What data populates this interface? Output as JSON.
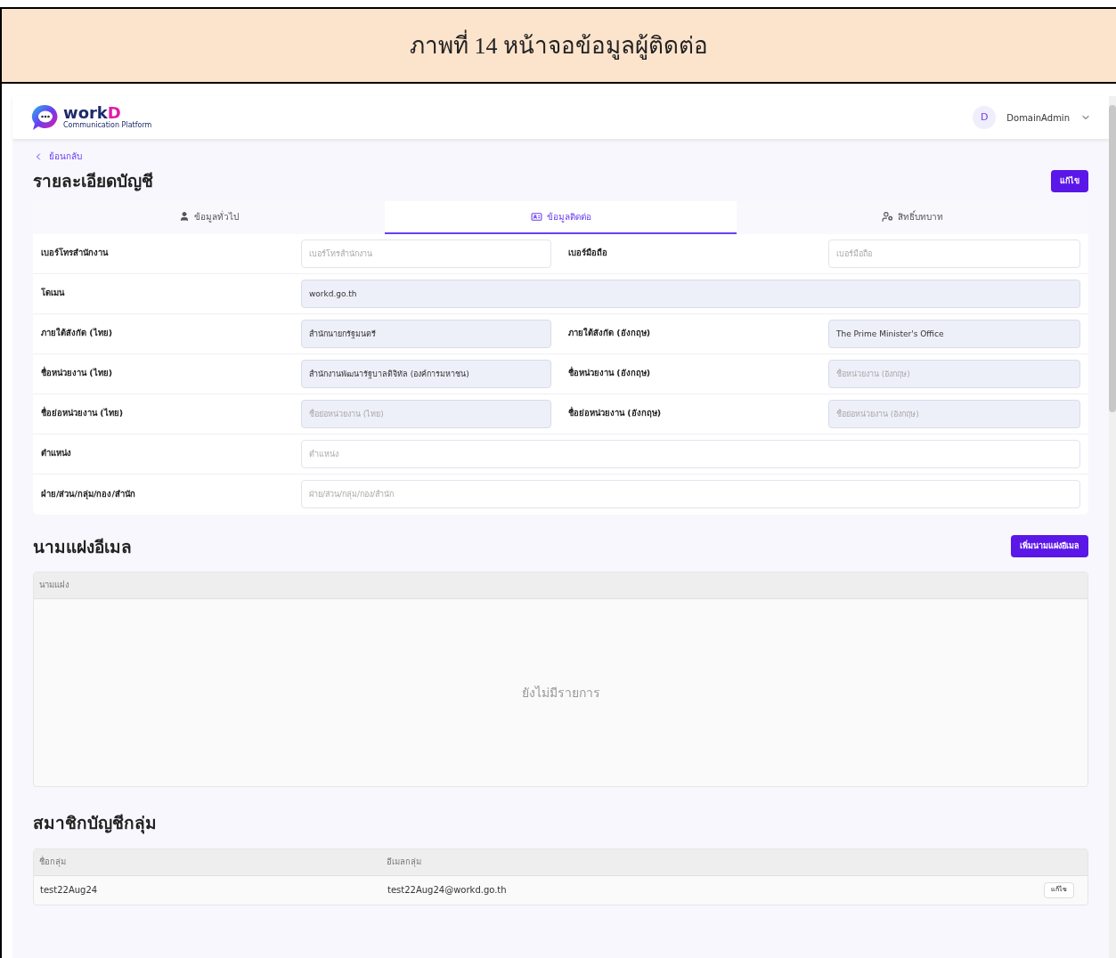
{
  "caption": "ภาพที่ 14 หน้าจอข้อมูลผู้ติดต่อ",
  "logo": {
    "main": "work",
    "accent": "D",
    "tagline": "Communication Platform"
  },
  "user": {
    "initial": "D",
    "name": "DomainAdmin"
  },
  "back": "ย้อนกลับ",
  "title": "รายละเอียดบัญชี",
  "edit_button": "แก้ไข",
  "tabs": [
    {
      "label": "ข้อมูลทั่วไป",
      "kind": "user",
      "selected": false
    },
    {
      "label": "ข้อมูลติดต่อ",
      "kind": "card",
      "selected": true
    },
    {
      "label": "สิทธิ์บทบาท",
      "kind": "user-gear",
      "selected": false
    }
  ],
  "form_rows": [
    {
      "kind": "pair",
      "fields": [
        {
          "label": "เบอร์โทรสำนักงาน",
          "placeholder": "เบอร์โทรสำนักงาน",
          "readonly": false
        },
        {
          "label": "เบอร์มือถือ",
          "placeholder": "เบอร์มือถือ",
          "readonly": false
        }
      ]
    },
    {
      "kind": "wide",
      "fields": [
        {
          "label": "โดเมน",
          "value": "workd.go.th",
          "readonly": true
        }
      ]
    },
    {
      "kind": "pair",
      "fields": [
        {
          "label": "ภายใต้สังกัด (ไทย)",
          "value": "สำนักนายกรัฐมนตรี",
          "readonly": true
        },
        {
          "label": "ภายใต้สังกัด (อังกฤษ)",
          "value": "The Prime Minister's Office",
          "readonly": true
        }
      ]
    },
    {
      "kind": "pair",
      "fields": [
        {
          "label": "ชื่อหน่วยงาน (ไทย)",
          "value": "สำนักงานพัฒนารัฐบาลดิจิทัล (องค์การมหาชน)",
          "readonly": true
        },
        {
          "label": "ชื่อหน่วยงาน (อังกฤษ)",
          "placeholder": "ชื่อหน่วยงาน (อังกฤษ)",
          "readonly": true
        }
      ]
    },
    {
      "kind": "pair",
      "fields": [
        {
          "label": "ชื่อย่อหน่วยงาน (ไทย)",
          "placeholder": "ชื่อย่อหน่วยงาน (ไทย)",
          "readonly": true
        },
        {
          "label": "ชื่อย่อหน่วยงาน (อังกฤษ)",
          "placeholder": "ชื่อย่อหน่วยงาน (อังกฤษ)",
          "readonly": true
        }
      ]
    },
    {
      "kind": "wide",
      "fields": [
        {
          "label": "ตำแหน่ง",
          "placeholder": "ตำแหน่ง",
          "readonly": false
        }
      ]
    },
    {
      "kind": "wide",
      "fields": [
        {
          "label": "ฝ่าย/ส่วน/กลุ่ม/กอง/สำนัก",
          "placeholder": "ฝ่าย/ส่วน/กลุ่ม/กอง/สำนัก",
          "readonly": false
        }
      ]
    }
  ],
  "alias": {
    "title": "นามแฝงอีเมล",
    "add_button": "เพิ่มนามแฝงอีเมล",
    "columns": [
      "นามแฝง"
    ],
    "empty": "ยังไม่มีรายการ"
  },
  "groups": {
    "title": "สมาชิกบัญชีกลุ่ม",
    "columns": [
      "ชื่อกลุ่ม",
      "อีเมลกลุ่ม"
    ],
    "rows": [
      {
        "cells": [
          "test22Aug24",
          "test22Aug24@workd.go.th"
        ],
        "action": "แก้ไข"
      }
    ]
  }
}
